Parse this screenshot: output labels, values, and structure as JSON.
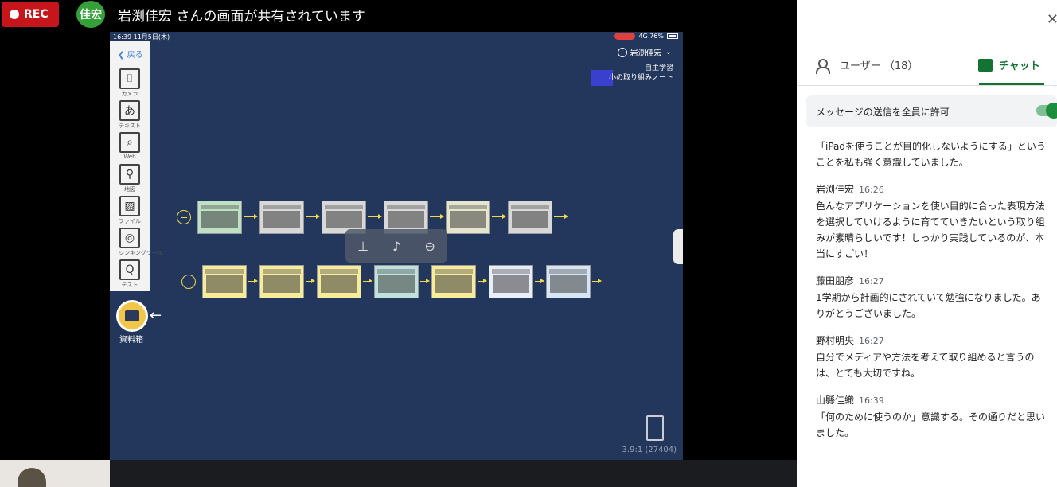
{
  "meeting": {
    "rec_label": "REC",
    "presenter_avatar": "佳宏",
    "share_title": "岩渕佳宏 さんの画面が共有されています"
  },
  "ipad": {
    "status_time": "16:39",
    "status_date": "11月5日(木)",
    "status_right": "4G 76%",
    "back_label": "戻る",
    "tools": [
      {
        "icon": "camera-icon",
        "glyph": "⌷",
        "label": "カメラ"
      },
      {
        "icon": "text-icon",
        "glyph": "あ",
        "label": "テキスト"
      },
      {
        "icon": "web-search-icon",
        "glyph": "⌕",
        "label": "Web"
      },
      {
        "icon": "map-icon",
        "glyph": "⚲",
        "label": "地図"
      },
      {
        "icon": "file-image-icon",
        "glyph": "▨",
        "label": "ファイル"
      },
      {
        "icon": "thinking-tool-icon",
        "glyph": "◎",
        "label": "シンキングツール"
      },
      {
        "icon": "test-icon",
        "glyph": "Q",
        "label": "テスト"
      }
    ],
    "shiryo_label": "資料箱",
    "user_name": "岩渕佳宏",
    "note_line1": "自主学習",
    "note_line2": "小の取り組みノート",
    "ratio_text": "3.9:1 (27404)",
    "row1_colors": [
      "#bfe0c5",
      "#d8d8d8",
      "#d8d8d8",
      "#d8d8d8",
      "#e6e6cf",
      "#d8d8d8"
    ],
    "row2_colors": [
      "#f6ec9c",
      "#f6ec9c",
      "#f6ec9c",
      "#bfe3dc",
      "#f6ec9c",
      "#e8eef8",
      "#d7e6f4"
    ]
  },
  "panel": {
    "users_tab_label": "ユーザー （18）",
    "chat_tab_label": "チャット",
    "permit_label": "メッセージの送信を全員に許可",
    "cut_text": "…",
    "messages": [
      {
        "name": "",
        "time": "",
        "text": "「iPadを使うことが目的化しないようにする」ということを私も強く意識していました。"
      },
      {
        "name": "岩渕佳宏",
        "time": "16:26",
        "text": "色んなアプリケーションを使い目的に合った表現方法を選択していけるように育てていきたいという取り組みが素晴らしいです！しっかり実践しているのが、本当にすごい！"
      },
      {
        "name": "藤田朋彦",
        "time": "16:27",
        "text": "1学期から計画的にされていて勉強になりました。ありがとうございました。"
      },
      {
        "name": "野村明央",
        "time": "16:27",
        "text": "自分でメディアや方法を考えて取り組めると言うのは、とても大切ですね。"
      },
      {
        "name": "山縣佳織",
        "time": "16:39",
        "text": "「何のために使うのか」意識する。その通りだと思いました。"
      }
    ]
  }
}
